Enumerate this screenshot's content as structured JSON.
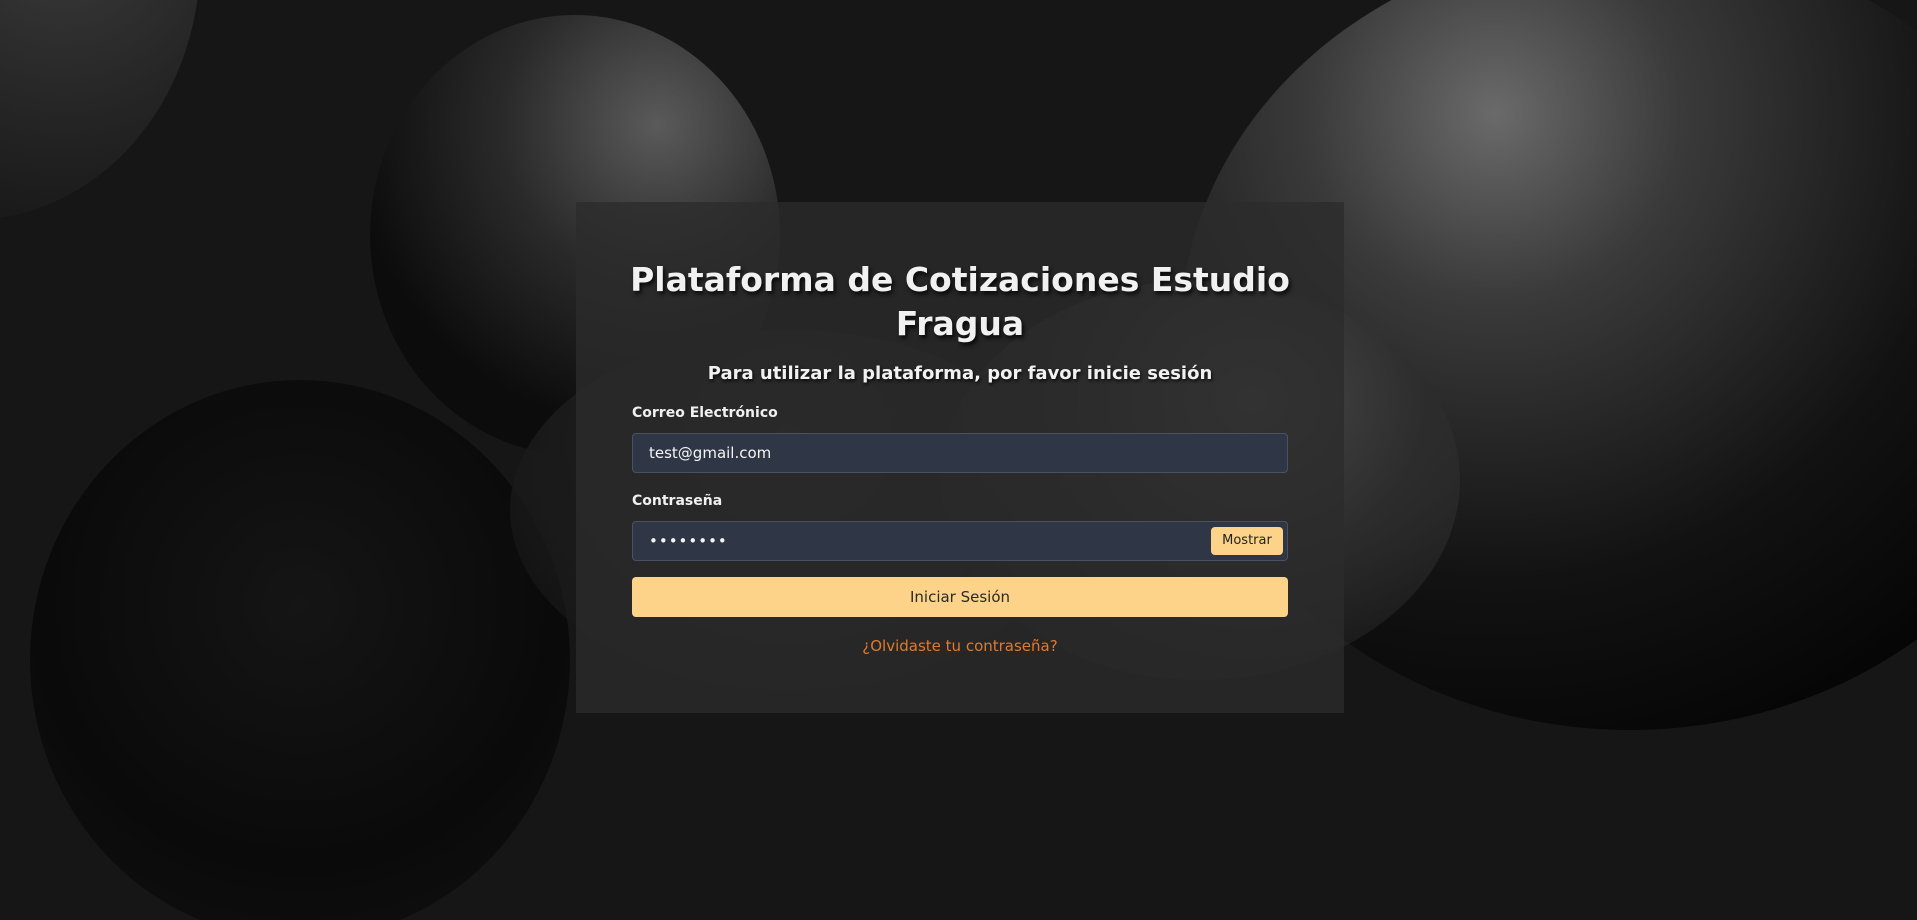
{
  "login": {
    "title": "Plataforma de Cotizaciones Estudio Fragua",
    "subtitle": "Para utilizar la plataforma, por favor inicie sesión",
    "email_label": "Correo Electrónico",
    "email_value": "test@gmail.com",
    "password_label": "Contraseña",
    "password_value": "••••••••",
    "show_button": "Mostrar",
    "submit_button": "Iniciar Sesión",
    "forgot_link": "¿Olvidaste tu contraseña?"
  },
  "colors": {
    "accent": "#fcd389",
    "link": "#e07a2e",
    "input_bg": "#2f3645",
    "card_bg": "#2c2c2c",
    "page_bg": "#161616"
  }
}
